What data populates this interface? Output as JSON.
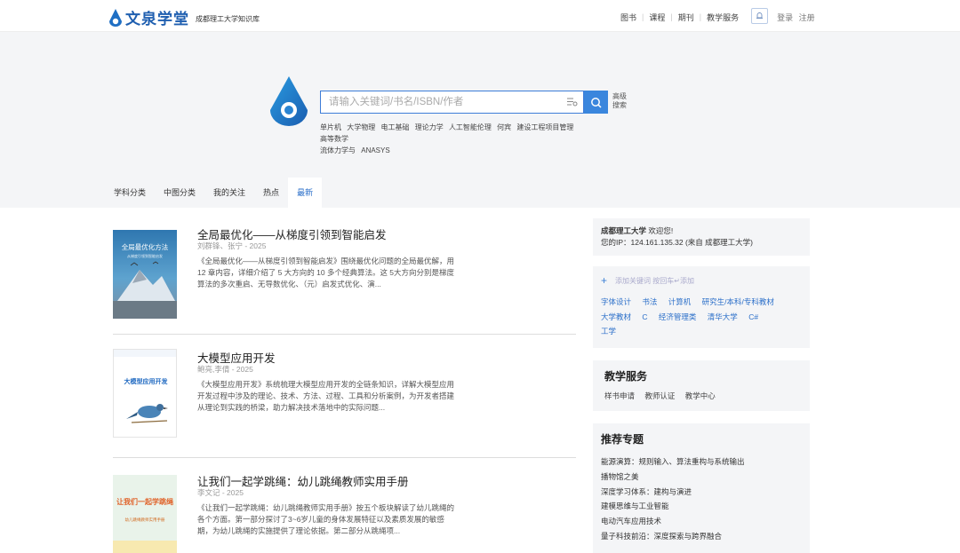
{
  "header": {
    "brand": "文泉学堂",
    "subtitle": "成都理工大学知识库",
    "nav": [
      "图书",
      "课程",
      "期刊",
      "教学服务"
    ],
    "login": "登录",
    "register": "注册"
  },
  "search": {
    "placeholder": "请输入关键词/书名/ISBN/作者",
    "advanced": "高级搜索",
    "hot_keywords": [
      "单片机",
      "大学物理",
      "电工基础",
      "理论力学",
      "人工智能伦理",
      "何宾",
      "建设工程项目管理",
      "高等数学",
      "流体力学与",
      "ANASYS"
    ]
  },
  "tabs": [
    "学科分类",
    "中图分类",
    "我的关注",
    "热点",
    "最新"
  ],
  "active_tab": "最新",
  "books": [
    {
      "title": "全局最优化——从梯度引领到智能启发",
      "meta": "刘群锋、张宁 - 2025",
      "desc": "《全局最优化——从梯度引领到智能启发》围绕最优化问题的全局最优解，用 12 章内容，详细介绍了 5 大方向的 10 多个经典算法。这 5大方向分别是梯度算法的多次重启、无导数优化、（元）启发式优化、演...",
      "cover_title": "全局最优化方法",
      "cover_sub": "从梯度引领到智能启发"
    },
    {
      "title": "大模型应用开发",
      "meta": "鲍亮,李倩 - 2025",
      "desc": "《大模型应用开发》系统梳理大模型应用开发的全链条知识，详解大模型应用开发过程中涉及的理论、技术、方法、过程、工具和分析案例，为开发者搭建从理论到实践的桥梁，助力解决技术落地中的实际问题...",
      "cover_title": "大模型应用开发"
    },
    {
      "title": "让我们一起学跳绳：幼儿跳绳教师实用手册",
      "meta": "李文记 - 2025",
      "desc": "《让我们一起学跳绳：幼儿跳绳教师实用手册》按五个板块解读了幼儿跳绳的各个方面。第一部分探讨了3~6岁儿童的身体发展特征以及素质发展的敏感期，为幼儿跳绳的实施提供了理论依据。第二部分从跳绳项...",
      "cover_title": "让我们一起学跳绳",
      "cover_sub": "幼儿跳绳教师实用手册"
    }
  ],
  "welcome": {
    "school": "成都理工大学",
    "greeting": "欢迎您!",
    "ip_line": "您的IP：124.161.135.32 (来自 成都理工大学)"
  },
  "follow": {
    "hint": "添加关键词 按回车↵添加",
    "tags": [
      "字体设计",
      "书法",
      "计算机",
      "研究生/本科/专科教材",
      "大学教材",
      "C",
      "经济管理类",
      "清华大学",
      "C#",
      "工学"
    ]
  },
  "service": {
    "title": "教学服务",
    "links": [
      "样书申请",
      "教师认证",
      "教学中心"
    ]
  },
  "topics": {
    "title": "推荐专题",
    "items": [
      "能源演算：规则输入、算法重构与系统输出",
      "播物馆之美",
      "深度学习体系：建构与演进",
      "建模思维与工业智能",
      "电动汽车应用技术",
      "量子科技前沿：深度探索与跨界融合"
    ]
  },
  "colors": {
    "brand": "#1f5fb0",
    "accent": "#3a86dd",
    "link": "#2b6fc9"
  }
}
